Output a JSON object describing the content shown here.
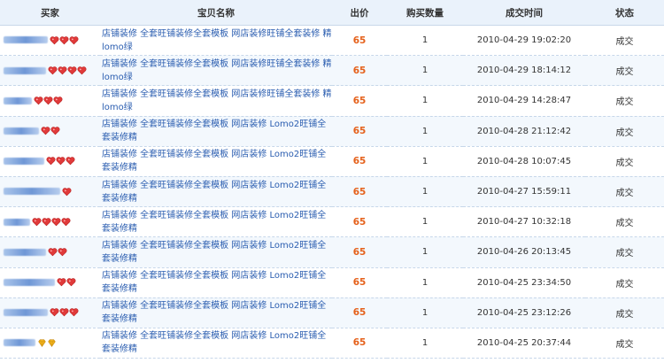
{
  "header": {
    "buyer": "买家",
    "item": "宝贝名称",
    "price": "出价",
    "qty": "购买数量",
    "time": "成交时间",
    "status": "状态"
  },
  "rows": [
    {
      "item": "店铺装修 全套旺铺装修全套模板 网店装修旺铺全套装修 精lomo绿",
      "price": "65",
      "qty": "1",
      "time": "2010-04-29 19:02:20",
      "status": "成交",
      "credit": "heart",
      "credit_count": 3
    },
    {
      "item": "店铺装修 全套旺铺装修全套模板 网店装修旺铺全套装修 精lomo绿",
      "price": "65",
      "qty": "1",
      "time": "2010-04-29 18:14:12",
      "status": "成交",
      "credit": "heart",
      "credit_count": 4
    },
    {
      "item": "店铺装修 全套旺铺装修全套模板 网店装修旺铺全套装修 精lomo绿",
      "price": "65",
      "qty": "1",
      "time": "2010-04-29 14:28:47",
      "status": "成交",
      "credit": "heart",
      "credit_count": 3
    },
    {
      "item": "店铺装修 全套旺铺装修全套模板 网店装修 Lomo2旺铺全套装修精",
      "price": "65",
      "qty": "1",
      "time": "2010-04-28 21:12:42",
      "status": "成交",
      "credit": "heart",
      "credit_count": 2
    },
    {
      "item": "店铺装修 全套旺铺装修全套模板 网店装修 Lomo2旺铺全套装修精",
      "price": "65",
      "qty": "1",
      "time": "2010-04-28 10:07:45",
      "status": "成交",
      "credit": "heart",
      "credit_count": 3
    },
    {
      "item": "店铺装修 全套旺铺装修全套模板 网店装修 Lomo2旺铺全套装修精",
      "price": "65",
      "qty": "1",
      "time": "2010-04-27 15:59:11",
      "status": "成交",
      "credit": "heart",
      "credit_count": 1
    },
    {
      "item": "店铺装修 全套旺铺装修全套模板 网店装修 Lomo2旺铺全套装修精",
      "price": "65",
      "qty": "1",
      "time": "2010-04-27 10:32:18",
      "status": "成交",
      "credit": "heart",
      "credit_count": 4
    },
    {
      "item": "店铺装修 全套旺铺装修全套模板 网店装修 Lomo2旺铺全套装修精",
      "price": "65",
      "qty": "1",
      "time": "2010-04-26 20:13:45",
      "status": "成交",
      "credit": "heart",
      "credit_count": 2
    },
    {
      "item": "店铺装修 全套旺铺装修全套模板 网店装修 Lomo2旺铺全套装修精",
      "price": "65",
      "qty": "1",
      "time": "2010-04-25 23:34:50",
      "status": "成交",
      "credit": "heart",
      "credit_count": 2
    },
    {
      "item": "店铺装修 全套旺铺装修全套模板 网店装修 Lomo2旺铺全套装修精",
      "price": "65",
      "qty": "1",
      "time": "2010-04-25 23:12:26",
      "status": "成交",
      "credit": "heart",
      "credit_count": 3
    },
    {
      "item": "店铺装修 全套旺铺装修全套模板 网店装修 Lomo2旺铺全套装修精",
      "price": "65",
      "qty": "1",
      "time": "2010-04-25 20:37:44",
      "status": "成交",
      "credit": "diamond",
      "credit_count": 2
    }
  ]
}
